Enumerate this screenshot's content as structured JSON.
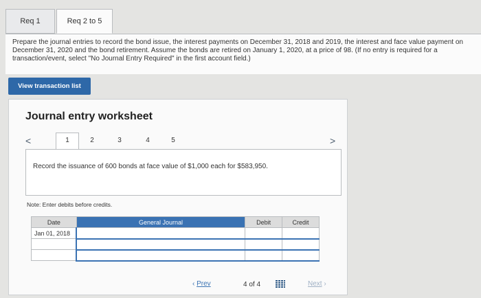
{
  "tabs": [
    {
      "label": "Req 1"
    },
    {
      "label": "Req 2 to 5"
    }
  ],
  "instructions": "Prepare the journal entries to record the bond issue, the interest payments on December 31, 2018 and 2019, the interest and face value payment on December 31, 2020 and the bond retirement. Assume the bonds are retired on January 1, 2020, at a price of 98. (If no entry is required for a transaction/event, select \"No Journal Entry Required\" in the first account field.)",
  "view_button": "View transaction list",
  "worksheet": {
    "title": "Journal entry worksheet",
    "nav": {
      "prev_icon": "<",
      "next_icon": ">",
      "numbers": [
        "1",
        "2",
        "3",
        "4",
        "5"
      ]
    },
    "description": "Record the issuance of 600 bonds at face value of $1,000 each for $583,950.",
    "note": "Note: Enter debits before credits.",
    "table": {
      "headers": [
        "Date",
        "General Journal",
        "Debit",
        "Credit"
      ],
      "rows": [
        {
          "date": "Jan 01, 2018"
        },
        {
          "date": ""
        },
        {
          "date": ""
        }
      ]
    }
  },
  "footer": {
    "prev": "Prev",
    "page_current": "4",
    "page_sep": "of",
    "page_total": "4",
    "next": "Next"
  }
}
